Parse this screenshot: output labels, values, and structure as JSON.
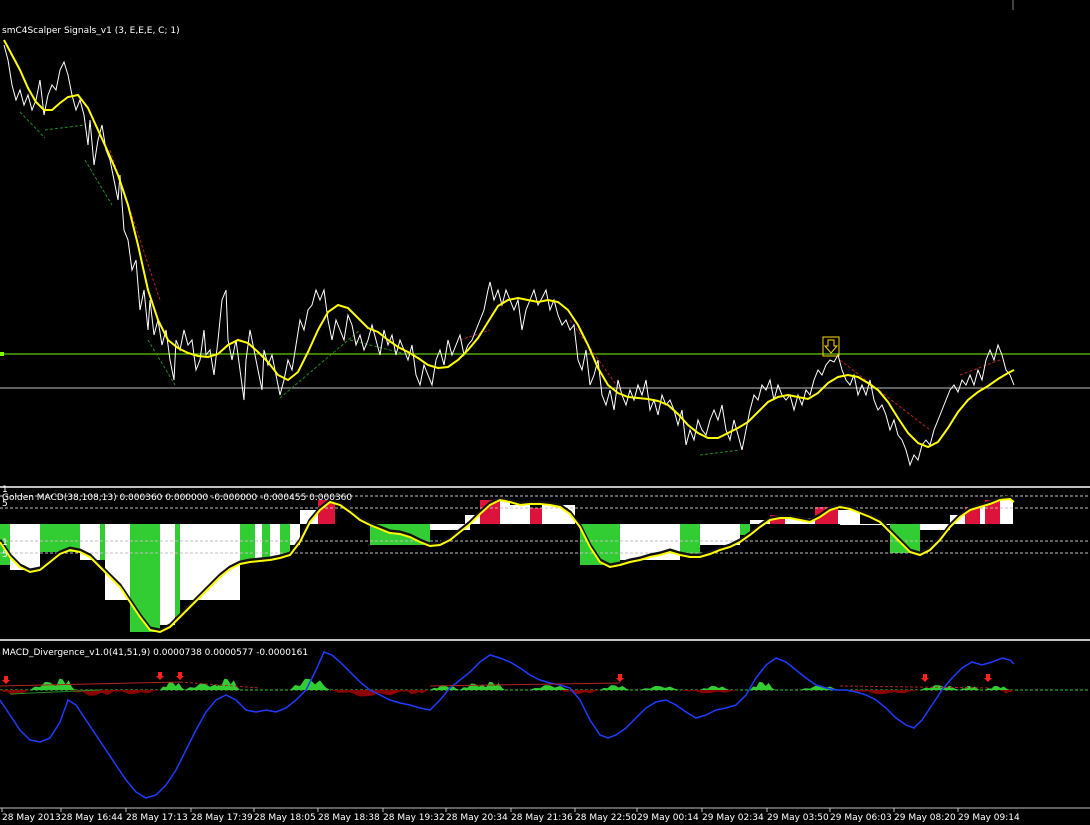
{
  "colors": {
    "background": "#000000",
    "price": "#ffffff",
    "ma": "#ffff00",
    "level": "#7cfc00",
    "separator": "#c0c0c0",
    "hist_green": "#32cd32",
    "hist_red": "#dc143c",
    "hist_white": "#ffffff",
    "macd_blue": "#1e3cff",
    "div_red": "#8b0000",
    "signal_arrow": "#ffd700"
  },
  "main_panel": {
    "indicator_label": "smC4Scalper Signals_v1 (3, E,E,E, C; 1)",
    "signal_icon": "down-arrow-signal-icon"
  },
  "macd_panel": {
    "indicator_label": "Golden MACD(38,108,13) 0.000360 0.000000 -0.000000 -0.000455 0.000360",
    "level_labels": [
      "1",
      "5",
      "1",
      "5"
    ]
  },
  "divergence_panel": {
    "indicator_label": "MACD_Divergence_v1.0(41,51,9) 0.0000738 0.0000577 -0.0000161"
  },
  "time_axis": {
    "ticks": [
      "28 May 2013",
      "28 May 16:44",
      "28 May 17:13",
      "28 May 17:39",
      "28 May 18:05",
      "28 May 18:38",
      "28 May 19:32",
      "28 May 20:34",
      "28 May 21:36",
      "28 May 22:50",
      "29 May 00:14",
      "29 May 02:34",
      "29 May 03:50",
      "29 May 06:03",
      "29 May 08:20",
      "29 May 09:14"
    ]
  }
}
